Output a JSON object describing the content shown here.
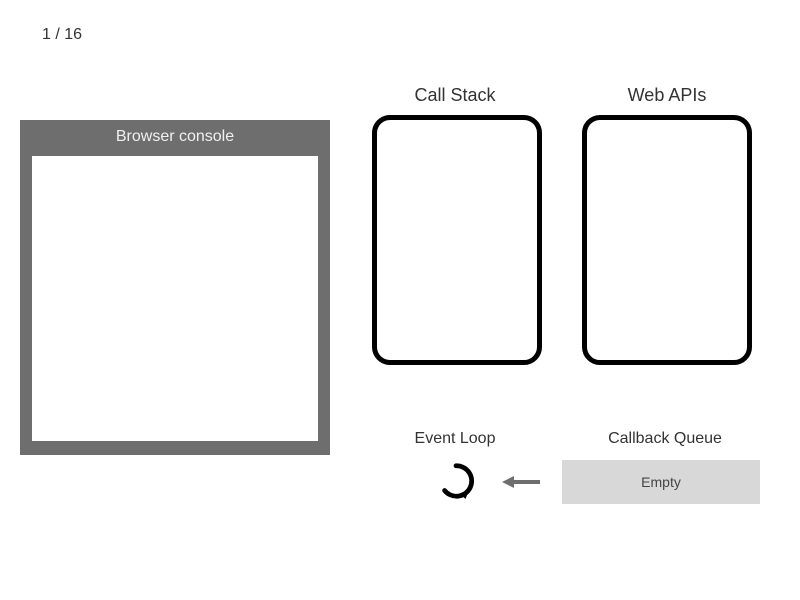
{
  "pager": {
    "text": "1 / 16"
  },
  "console": {
    "title": "Browser console"
  },
  "labels": {
    "callstack": "Call Stack",
    "webapis": "Web APIs",
    "eventloop": "Event Loop",
    "cbqueue": "Callback Queue"
  },
  "queue": {
    "status": "Empty"
  }
}
